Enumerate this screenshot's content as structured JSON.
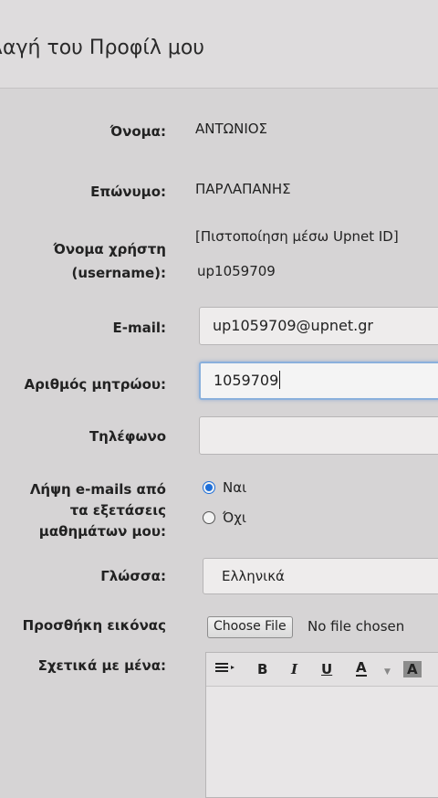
{
  "header": {
    "title": "λαγή του Προφίλ μου"
  },
  "form": {
    "first_name": {
      "label": "Όνομα:",
      "value": "ΑΝΤΩΝΙΟΣ"
    },
    "last_name": {
      "label": "Επώνυμο:",
      "value": "ΠΑΡΛΑΠΑΝΗΣ"
    },
    "username": {
      "label_line1": "Όνομα χρήστη",
      "label_line2": "(username):",
      "note": "[Πιστοποίηση μέσω Upnet ID]",
      "value": "up1059709"
    },
    "email": {
      "label": "E-mail:",
      "value": "up1059709@upnet.gr"
    },
    "registration_number": {
      "label": "Αριθμός μητρώου:",
      "value": "1059709"
    },
    "phone": {
      "label": "Τηλέφωνο",
      "value": ""
    },
    "exam_emails": {
      "label_line1": "Λήψη e-mails από",
      "label_line2": "τα εξετάσεις",
      "label_line3": "μαθημάτων μου:",
      "options": [
        "Ναι",
        "Όχι"
      ],
      "selected": "Ναι"
    },
    "language": {
      "label": "Γλώσσα:",
      "value": "Ελληνικά"
    },
    "image": {
      "label": "Προσθήκη εικόνας",
      "button": "Choose File",
      "status": "No file chosen"
    },
    "about": {
      "label": "Σχετικά με μένα:",
      "toolbar": {
        "list_icon": "list-icon",
        "bold": "B",
        "italic": "I",
        "underline": "U",
        "font_color": "A",
        "highlight": "A"
      }
    }
  }
}
